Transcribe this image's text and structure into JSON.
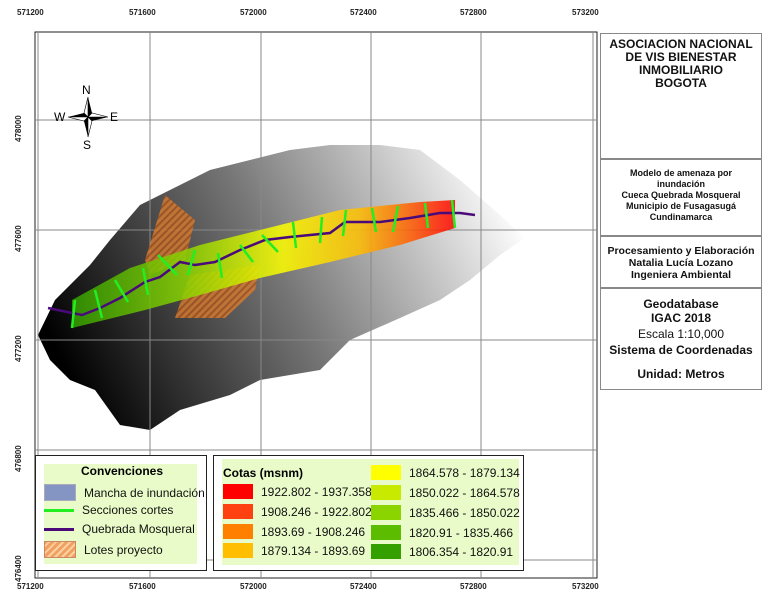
{
  "axes": {
    "x_ticks": [
      "571200",
      "571600",
      "572000",
      "572400",
      "572800",
      "573200"
    ],
    "y_ticks": [
      "478000",
      "477600",
      "477200",
      "476800",
      "476400"
    ]
  },
  "north_arrow": {
    "n": "N",
    "s": "S",
    "e": "E",
    "w": "W"
  },
  "title_panel": {
    "org": [
      "ASOCIACION NACIONAL",
      "DE VIS BIENESTAR",
      "INMOBILIARIO",
      "BOGOTA"
    ]
  },
  "model_panel": {
    "lines": [
      "Modelo de amenaza por",
      "inundación",
      "Cueca Quebrada Mosqueral",
      "Municipio de Fusagasugá",
      "Cundinamarca"
    ]
  },
  "author_panel": {
    "lines": [
      "Procesamiento y Elaboración",
      "Natalia Lucía Lozano",
      "Ingeniera Ambiental"
    ]
  },
  "info_panel": {
    "source1": "Geodatabase",
    "source2": "IGAC 2018",
    "scale": "Escala  1:10,000",
    "crs": "Sistema de Coordenadas",
    "units": "Unidad: Metros"
  },
  "conventions": {
    "title": "Convenciones",
    "items": [
      {
        "label": "Mancha de inundación",
        "color": "#8495c4"
      },
      {
        "label": "Secciones cortes",
        "color": "#22ee22"
      },
      {
        "label": "Quebrada Mosqueral",
        "color": "#4b0a7a"
      },
      {
        "label": "Lotes proyecto",
        "color": "#f0a060"
      }
    ]
  },
  "elevation": {
    "title": "Cotas (msnm)",
    "classes": [
      {
        "label": "1922.802 - 1937.358",
        "color": "#ff0000"
      },
      {
        "label": "1908.246 - 1922.802",
        "color": "#ff4010"
      },
      {
        "label": "1893.69 - 1908.246",
        "color": "#ff8000"
      },
      {
        "label": "1879.134 - 1893.69",
        "color": "#ffbf00"
      },
      {
        "label": "1864.578 - 1879.134",
        "color": "#ffff00"
      },
      {
        "label": "1850.022 - 1864.578",
        "color": "#c8ea00"
      },
      {
        "label": "1835.466 - 1850.022",
        "color": "#8cd400"
      },
      {
        "label": "1820.91 - 1835.466",
        "color": "#5cbc00"
      },
      {
        "label": "1806.354 - 1820.91",
        "color": "#34a000"
      }
    ]
  }
}
